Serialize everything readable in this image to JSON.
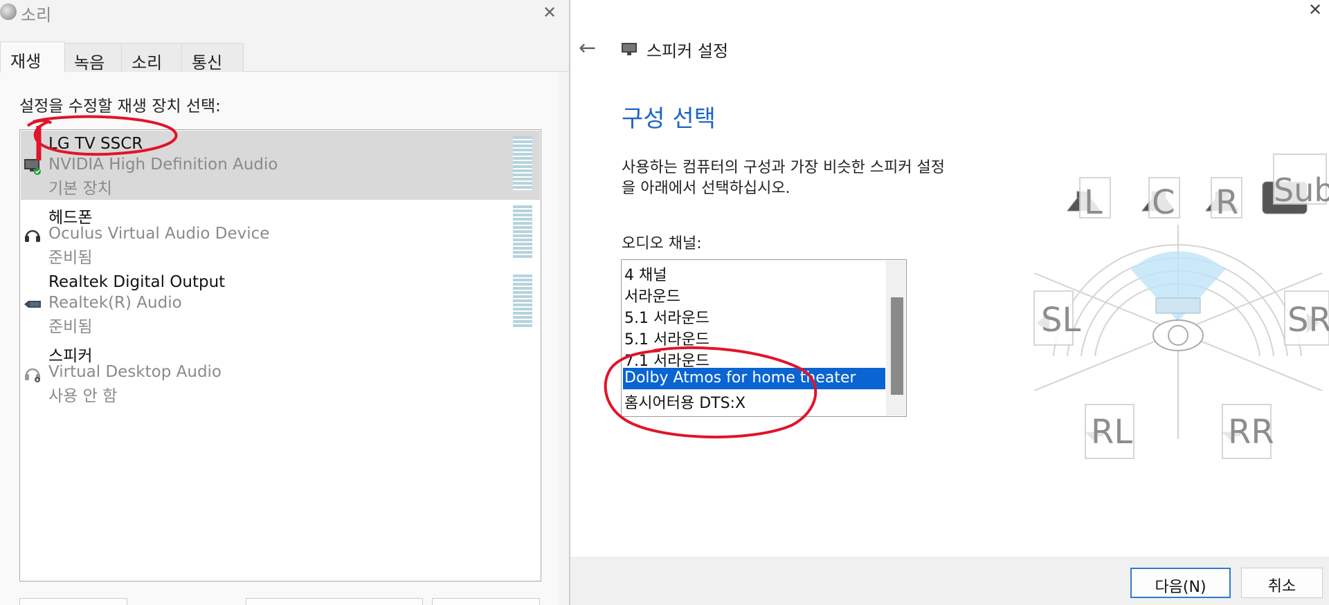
{
  "sound_dialog": {
    "title": "소리",
    "close_glyph": "✕",
    "tabs": [
      {
        "label": "재생",
        "active": true
      },
      {
        "label": "녹음",
        "active": false
      },
      {
        "label": "소리",
        "active": false
      },
      {
        "label": "통신",
        "active": false
      }
    ],
    "instruction": "설정을 수정할 재생 장치 선택:",
    "devices": [
      {
        "name": "LG TV SSCR",
        "driver": "NVIDIA High Definition Audio",
        "status": "기본 장치",
        "icon": "monitor-icon",
        "selected": true
      },
      {
        "name": "헤드폰",
        "driver": "Oculus Virtual Audio Device",
        "status": "준비됨",
        "icon": "headphones-icon",
        "selected": false
      },
      {
        "name": "Realtek Digital Output",
        "driver": "Realtek(R) Audio",
        "status": "준비됨",
        "icon": "digital-output-icon",
        "selected": false
      },
      {
        "name": "스피커",
        "driver": "Virtual Desktop Audio",
        "status": "사용 안 함",
        "icon": "speaker-disabled-icon",
        "selected": false
      }
    ]
  },
  "speaker_setup": {
    "back_glyph": "←",
    "close_glyph": "✕",
    "window_title": "스피커 설정",
    "heading": "구성 선택",
    "description_line1": "사용하는 컴퓨터의 구성과 가장 비슷한 스피커 설정",
    "description_line2": "을 아래에서 선택하십시오.",
    "channel_label": "오디오 채널:",
    "options": [
      {
        "label": "4 채널",
        "selected": false
      },
      {
        "label": "서라운드",
        "selected": false
      },
      {
        "label": "5.1 서라운드",
        "selected": false
      },
      {
        "label": "5.1 서라운드",
        "selected": false
      },
      {
        "label": "7.1 서라운드",
        "selected": false
      },
      {
        "label": "Dolby Atmos for home theater",
        "selected": true
      },
      {
        "label": "홈시어터용 DTS:X",
        "selected": false
      }
    ],
    "speakers": {
      "left": "L",
      "center": "C",
      "right": "R",
      "sub": "Sub",
      "side_left": "SL",
      "side_right": "SR",
      "rear_left": "RL",
      "rear_right": "RR"
    },
    "next_button": "다음(N)",
    "cancel_button": "취소"
  },
  "colors": {
    "accent": "#0a64d2",
    "heading": "#1c64c8",
    "annotation": "#e0142a"
  }
}
